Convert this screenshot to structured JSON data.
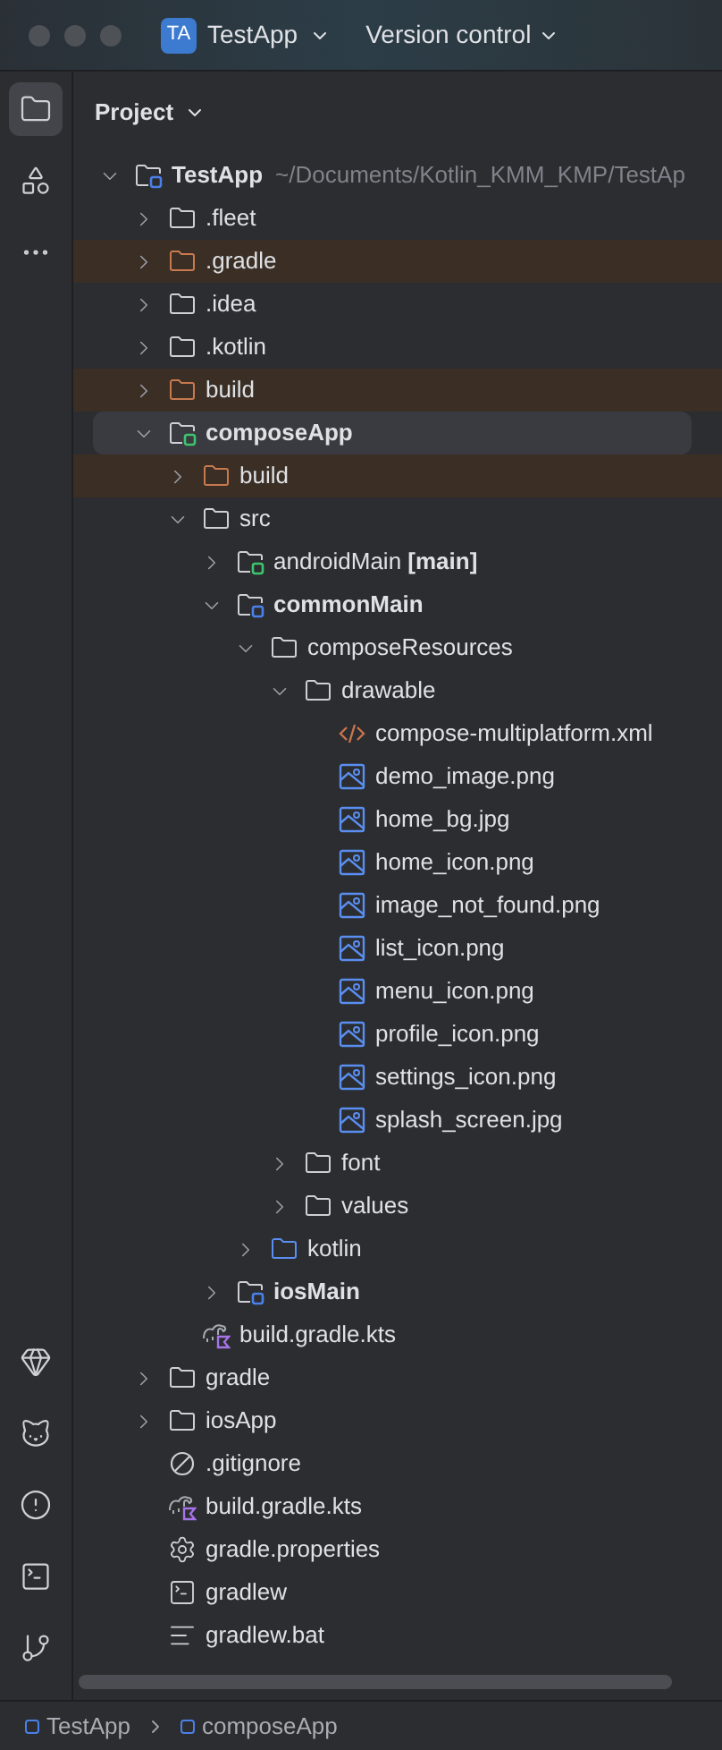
{
  "window": {
    "badge": "TA",
    "project": "TestApp",
    "vcs": "Version control"
  },
  "tool_strip": {
    "top": [
      {
        "kind": "project",
        "selected": true
      },
      {
        "kind": "structure",
        "selected": false
      },
      {
        "kind": "more",
        "selected": false
      }
    ],
    "bottom": [
      {
        "kind": "gem",
        "selected": false
      },
      {
        "kind": "cat",
        "selected": false
      },
      {
        "kind": "problems",
        "selected": false
      },
      {
        "kind": "terminal",
        "selected": false
      },
      {
        "kind": "git",
        "selected": false
      }
    ]
  },
  "panel": {
    "title": "Project"
  },
  "tree": [
    {
      "label": "TestApp",
      "path": "~/Documents/Kotlin_KMM_KMP/TestAp",
      "kind": "module",
      "color": "#4a80e8",
      "bold": true,
      "expanded": true,
      "children": [
        {
          "label": ".fleet",
          "kind": "folder",
          "expanded": false
        },
        {
          "label": ".gradle",
          "kind": "excluded",
          "expanded": false
        },
        {
          "label": ".idea",
          "kind": "folder",
          "expanded": false
        },
        {
          "label": ".kotlin",
          "kind": "folder",
          "expanded": false
        },
        {
          "label": "build",
          "kind": "excluded",
          "expanded": false
        },
        {
          "label": "composeApp",
          "kind": "module",
          "color": "#3ec46d",
          "bold": true,
          "selected": true,
          "expanded": true,
          "children": [
            {
              "label": "build",
              "kind": "excluded",
              "expanded": false
            },
            {
              "label": "src",
              "kind": "folder",
              "expanded": true,
              "children": [
                {
                  "label": "androidMain **[main]**",
                  "kind": "module",
                  "color": "#3ec46d",
                  "expanded": false
                },
                {
                  "label": "commonMain",
                  "kind": "module",
                  "color": "#4a80e8",
                  "bold": true,
                  "expanded": true,
                  "children": [
                    {
                      "label": "composeResources",
                      "kind": "folder",
                      "expanded": true,
                      "children": [
                        {
                          "label": "drawable",
                          "kind": "folder",
                          "expanded": true,
                          "children": [
                            {
                              "label": "compose-multiplatform.xml",
                              "kind": "xml"
                            },
                            {
                              "label": "demo_image.png",
                              "kind": "image"
                            },
                            {
                              "label": "home_bg.jpg",
                              "kind": "image"
                            },
                            {
                              "label": "home_icon.png",
                              "kind": "image"
                            },
                            {
                              "label": "image_not_found.png",
                              "kind": "image"
                            },
                            {
                              "label": "list_icon.png",
                              "kind": "image"
                            },
                            {
                              "label": "menu_icon.png",
                              "kind": "image"
                            },
                            {
                              "label": "profile_icon.png",
                              "kind": "image"
                            },
                            {
                              "label": "settings_icon.png",
                              "kind": "image"
                            },
                            {
                              "label": "splash_screen.jpg",
                              "kind": "image"
                            }
                          ]
                        },
                        {
                          "label": "font",
                          "kind": "folder",
                          "expanded": false
                        },
                        {
                          "label": "values",
                          "kind": "folder",
                          "expanded": false
                        }
                      ]
                    },
                    {
                      "label": "kotlin",
                      "kind": "source",
                      "expanded": false
                    }
                  ]
                },
                {
                  "label": "iosMain",
                  "kind": "module",
                  "color": "#4a80e8",
                  "bold": true,
                  "expanded": false
                }
              ]
            },
            {
              "label": "build.gradle.kts",
              "kind": "gradle"
            }
          ]
        },
        {
          "label": "gradle",
          "kind": "folder",
          "expanded": false
        },
        {
          "label": "iosApp",
          "kind": "folder",
          "expanded": false
        },
        {
          "label": ".gitignore",
          "kind": "ignore"
        },
        {
          "label": "build.gradle.kts",
          "kind": "gradle"
        },
        {
          "label": "gradle.properties",
          "kind": "settings"
        },
        {
          "label": "gradlew",
          "kind": "terminal"
        },
        {
          "label": "gradlew.bat",
          "kind": "text"
        }
      ]
    }
  ],
  "breadcrumbs": [
    {
      "label": "TestApp"
    },
    {
      "label": "composeApp"
    }
  ]
}
